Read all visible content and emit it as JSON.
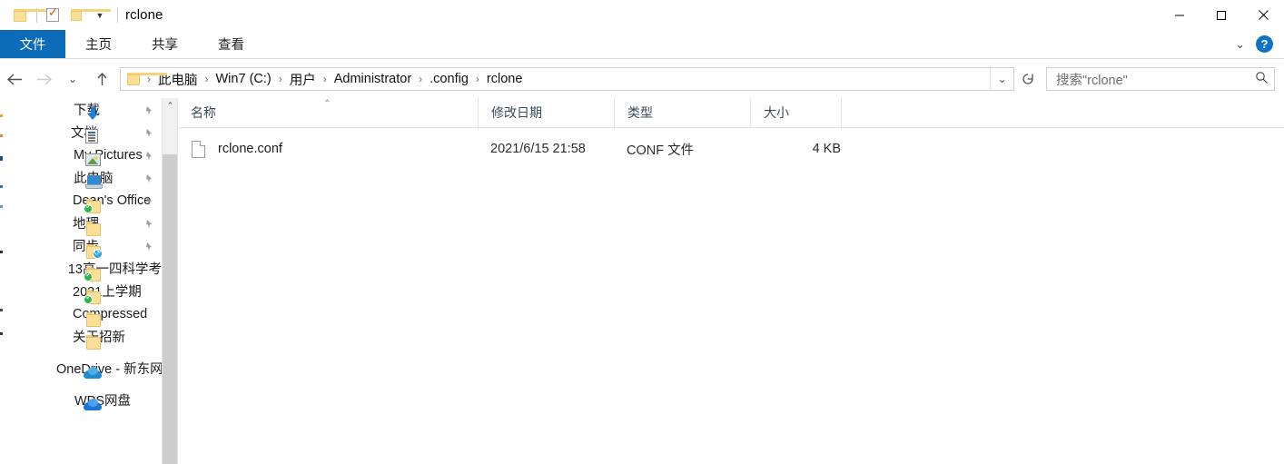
{
  "window": {
    "title": "rclone",
    "quick_access": [
      {
        "name": "folder-icon",
        "label": ""
      },
      {
        "name": "properties-icon",
        "label": ""
      },
      {
        "name": "new-folder-icon",
        "label": ""
      },
      {
        "name": "customize-qat-caret",
        "label": ""
      }
    ],
    "controls": {
      "minimize": "minimize-button",
      "maximize": "maximize-button",
      "close": "close-button"
    }
  },
  "ribbon": {
    "tabs": [
      {
        "label": "文件",
        "active": true
      },
      {
        "label": "主页",
        "active": false
      },
      {
        "label": "共享",
        "active": false
      },
      {
        "label": "查看",
        "active": false
      }
    ],
    "expand_icon": "chevron-down-icon",
    "help_label": "?"
  },
  "address": {
    "back": "←",
    "forward": "→",
    "history": "⌄",
    "up": "↑",
    "crumbs": [
      "此电脑",
      "Win7 (C:)",
      "用户",
      "Administrator",
      ".config",
      "rclone"
    ],
    "separator": "›",
    "dropdown": "⌄",
    "refresh": "refresh-icon"
  },
  "search": {
    "placeholder": "搜索\"rclone\"",
    "icon": "search-icon"
  },
  "sidebar": {
    "items": [
      {
        "label": "下载",
        "icon": "download-icon",
        "pinned": true,
        "indent": "lvl1"
      },
      {
        "label": "文档",
        "icon": "document-icon",
        "pinned": true,
        "indent": "lvl1"
      },
      {
        "label": "My Pictures",
        "icon": "pictures-icon",
        "pinned": true,
        "indent": "lvl1"
      },
      {
        "label": "此电脑",
        "icon": "this-pc-icon",
        "pinned": true,
        "indent": "lvl1"
      },
      {
        "label": "Dean's Office",
        "icon": "folder-sync-icon",
        "pinned": true,
        "indent": "lvl1"
      },
      {
        "label": "地理",
        "icon": "folder-icon",
        "pinned": true,
        "indent": "lvl1"
      },
      {
        "label": "同步",
        "icon": "folder-cloud-icon",
        "pinned": true,
        "indent": "lvl1"
      },
      {
        "label": "13高一四科学考",
        "icon": "folder-sync-icon",
        "pinned": false,
        "indent": "lvl1"
      },
      {
        "label": "2021上学期",
        "icon": "folder-sync-icon",
        "pinned": false,
        "indent": "lvl1"
      },
      {
        "label": "Compressed",
        "icon": "folder-icon",
        "pinned": false,
        "indent": "lvl1"
      },
      {
        "label": "关于招新",
        "icon": "folder-icon",
        "pinned": false,
        "indent": "lvl1"
      }
    ],
    "roots": [
      {
        "label": "OneDrive - 新东网",
        "icon": "onedrive-icon"
      },
      {
        "label": "WPS网盘",
        "icon": "wps-cloud-icon"
      }
    ],
    "scrollbar": {
      "up_arrow": "⌃"
    }
  },
  "filelist": {
    "columns": [
      {
        "label": "名称",
        "sorted": "asc"
      },
      {
        "label": "修改日期",
        "sorted": ""
      },
      {
        "label": "类型",
        "sorted": ""
      },
      {
        "label": "大小",
        "sorted": ""
      }
    ],
    "sort_caret": "⌃",
    "rows": [
      {
        "icon": "conf-file-icon",
        "name": "rclone.conf",
        "date": "2021/6/15 21:58",
        "type": "CONF 文件",
        "size": "4 KB"
      }
    ]
  }
}
